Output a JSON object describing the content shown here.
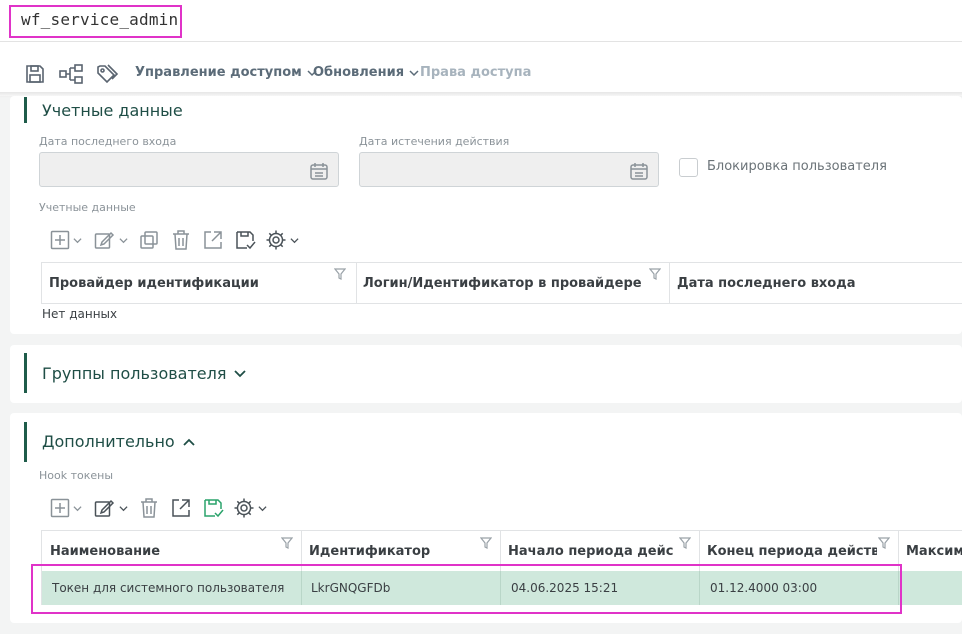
{
  "app": {
    "title": "wf_service_admin"
  },
  "toolbar": {
    "icons": [
      "save-icon",
      "tree-icon",
      "tags-icon"
    ],
    "menus": [
      {
        "label": "Управление доступом"
      },
      {
        "label": "Обновления"
      },
      {
        "label": "Права доступа"
      }
    ]
  },
  "credentials_section": {
    "title": "Учетные данные",
    "last_login_label": "Дата последнего входа",
    "last_login_value": "",
    "expiry_label": "Дата истечения действия",
    "expiry_value": "",
    "block_user_label": "Блокировка пользователя",
    "block_user_checked": false,
    "grid_label": "Учетные данные",
    "columns": [
      "Провайдер идентификации",
      "Логин/Идентификатор в провайдере",
      "Дата последнего входа"
    ],
    "empty_text": "Нет данных"
  },
  "groups_section": {
    "title": "Группы пользователя"
  },
  "additional_section": {
    "title": "Дополнительно",
    "grid_label": "Hook токены",
    "columns": [
      "Наименование",
      "Идентификатор",
      "Начало периода дейст…",
      "Конец периода действия",
      "Максима"
    ],
    "rows": [
      {
        "name": "Токен для системного пользователя",
        "id": "LkrGNQGFDb",
        "start": "04.06.2025 15:21",
        "end": "01.12.4000 03:00"
      }
    ]
  },
  "colors": {
    "accent": "#1f5c4a",
    "selected_row": "#cfe8dc",
    "highlight": "#e033c8"
  }
}
